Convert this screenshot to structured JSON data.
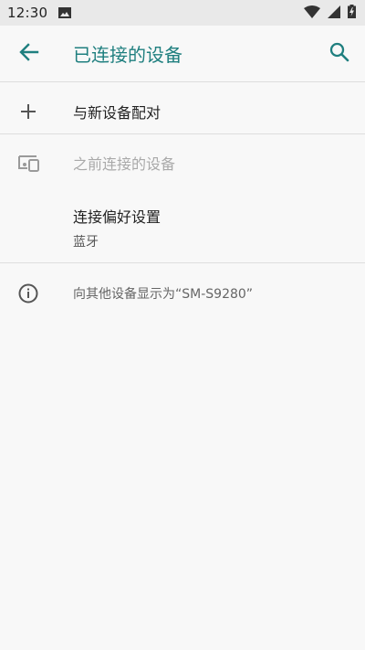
{
  "status_bar": {
    "time": "12:30",
    "icons": [
      "image-icon",
      "wifi-icon",
      "signal-icon",
      "battery-charging-icon"
    ]
  },
  "app_bar": {
    "title": "已连接的设备",
    "back_icon": "back-arrow-icon",
    "search_icon": "search-icon",
    "accent_color": "#1f7f7f"
  },
  "items": {
    "pair_new": {
      "label": "与新设备配对",
      "icon": "plus-icon"
    },
    "previously_connected": {
      "label": "之前连接的设备",
      "icon": "devices-icon"
    },
    "connection_prefs": {
      "title": "连接偏好设置",
      "subtitle": "蓝牙"
    },
    "visible_as": {
      "text": "向其他设备显示为“SM-S9280”",
      "icon": "info-icon"
    }
  }
}
